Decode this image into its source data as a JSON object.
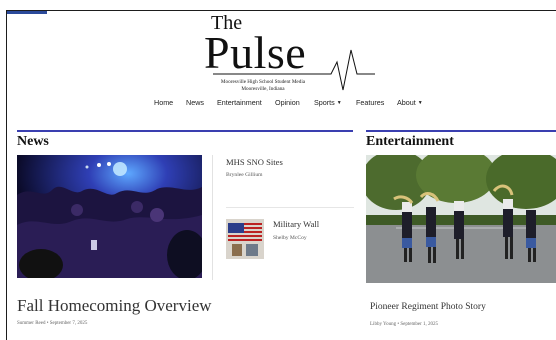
{
  "masthead": {
    "the": "The",
    "pulse": "Pulse",
    "subtitle_line1": "Mooresville High School Student Media",
    "subtitle_line2": "Mooresville, Indiana"
  },
  "nav": {
    "items": [
      "Home",
      "News",
      "Entertainment",
      "Opinion",
      "Sports",
      "Features",
      "About"
    ]
  },
  "news": {
    "heading": "News",
    "side_stories": [
      {
        "title": "MHS SNO Sites",
        "author": "Brynlee Gillium"
      },
      {
        "title": "Military Wall",
        "author": "Shelby McCoy"
      }
    ],
    "lead_headline": "Fall Homecoming Overview",
    "lead_byline": "Summer Reed • September 7, 2025"
  },
  "entertainment": {
    "heading": "Entertainment",
    "headline": "Pioneer Regiment Photo Story",
    "byline": "Libby Young • September 1, 2025"
  },
  "colors": {
    "accent_rule": "#3a3fb0",
    "text": "#222222"
  },
  "icons": {
    "dropdown": "chevron-down-icon"
  }
}
